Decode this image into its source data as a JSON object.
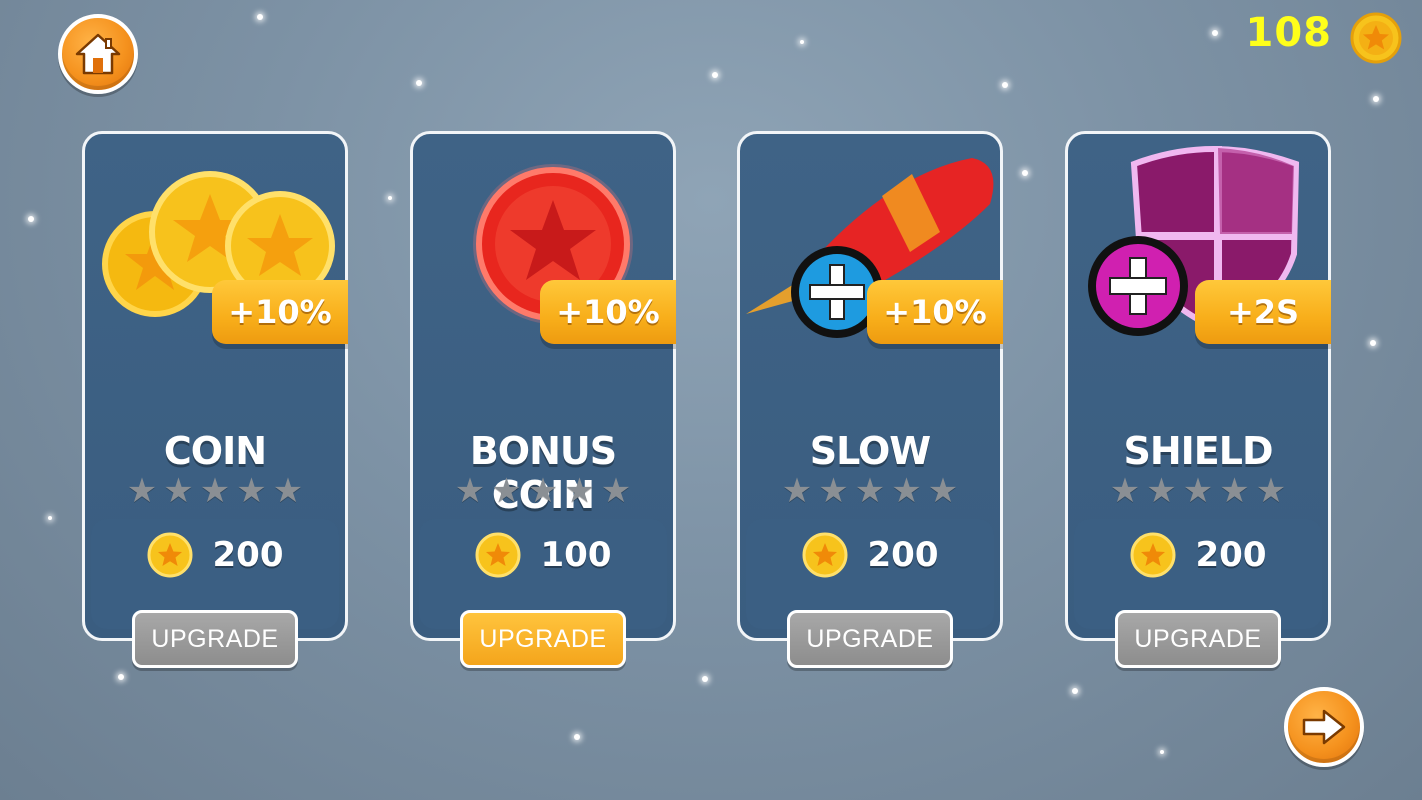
{
  "hud": {
    "coins": "108",
    "home_icon": "home-icon",
    "next_icon": "arrow-right-icon",
    "coin_icon": "star-coin-icon"
  },
  "cards": [
    {
      "id": "coin",
      "title": "COIN",
      "bonus": "+10%",
      "stars_filled": 0,
      "stars_total": 5,
      "price": "200",
      "button": "UPGRADE",
      "button_style": "gray",
      "icon": "gold-coins-icon"
    },
    {
      "id": "bonus-coin",
      "title": "BONUS COIN",
      "bonus": "+10%",
      "stars_filled": 0,
      "stars_total": 5,
      "price": "100",
      "button": "UPGRADE",
      "button_style": "orange",
      "icon": "red-star-coin-icon"
    },
    {
      "id": "slow",
      "title": "SLOW",
      "bonus": "+10%",
      "stars_filled": 0,
      "stars_total": 5,
      "price": "200",
      "button": "UPGRADE",
      "button_style": "gray",
      "icon": "rocket-icon"
    },
    {
      "id": "shield",
      "title": "SHIELD",
      "bonus": "+2S",
      "stars_filled": 0,
      "stars_total": 5,
      "price": "200",
      "button": "UPGRADE",
      "button_style": "gray",
      "icon": "shield-icon"
    }
  ],
  "colors": {
    "hud_coin_text": "#ffff1a",
    "card_bg": "#3f6386",
    "badge": "#f8ae1a",
    "upgrade_active": "#f4a51c",
    "upgrade_inactive": "#8d8d8d",
    "star_empty": "#8a8f94",
    "blue_plus": "#1e9be0",
    "magenta_plus": "#d020b0"
  }
}
